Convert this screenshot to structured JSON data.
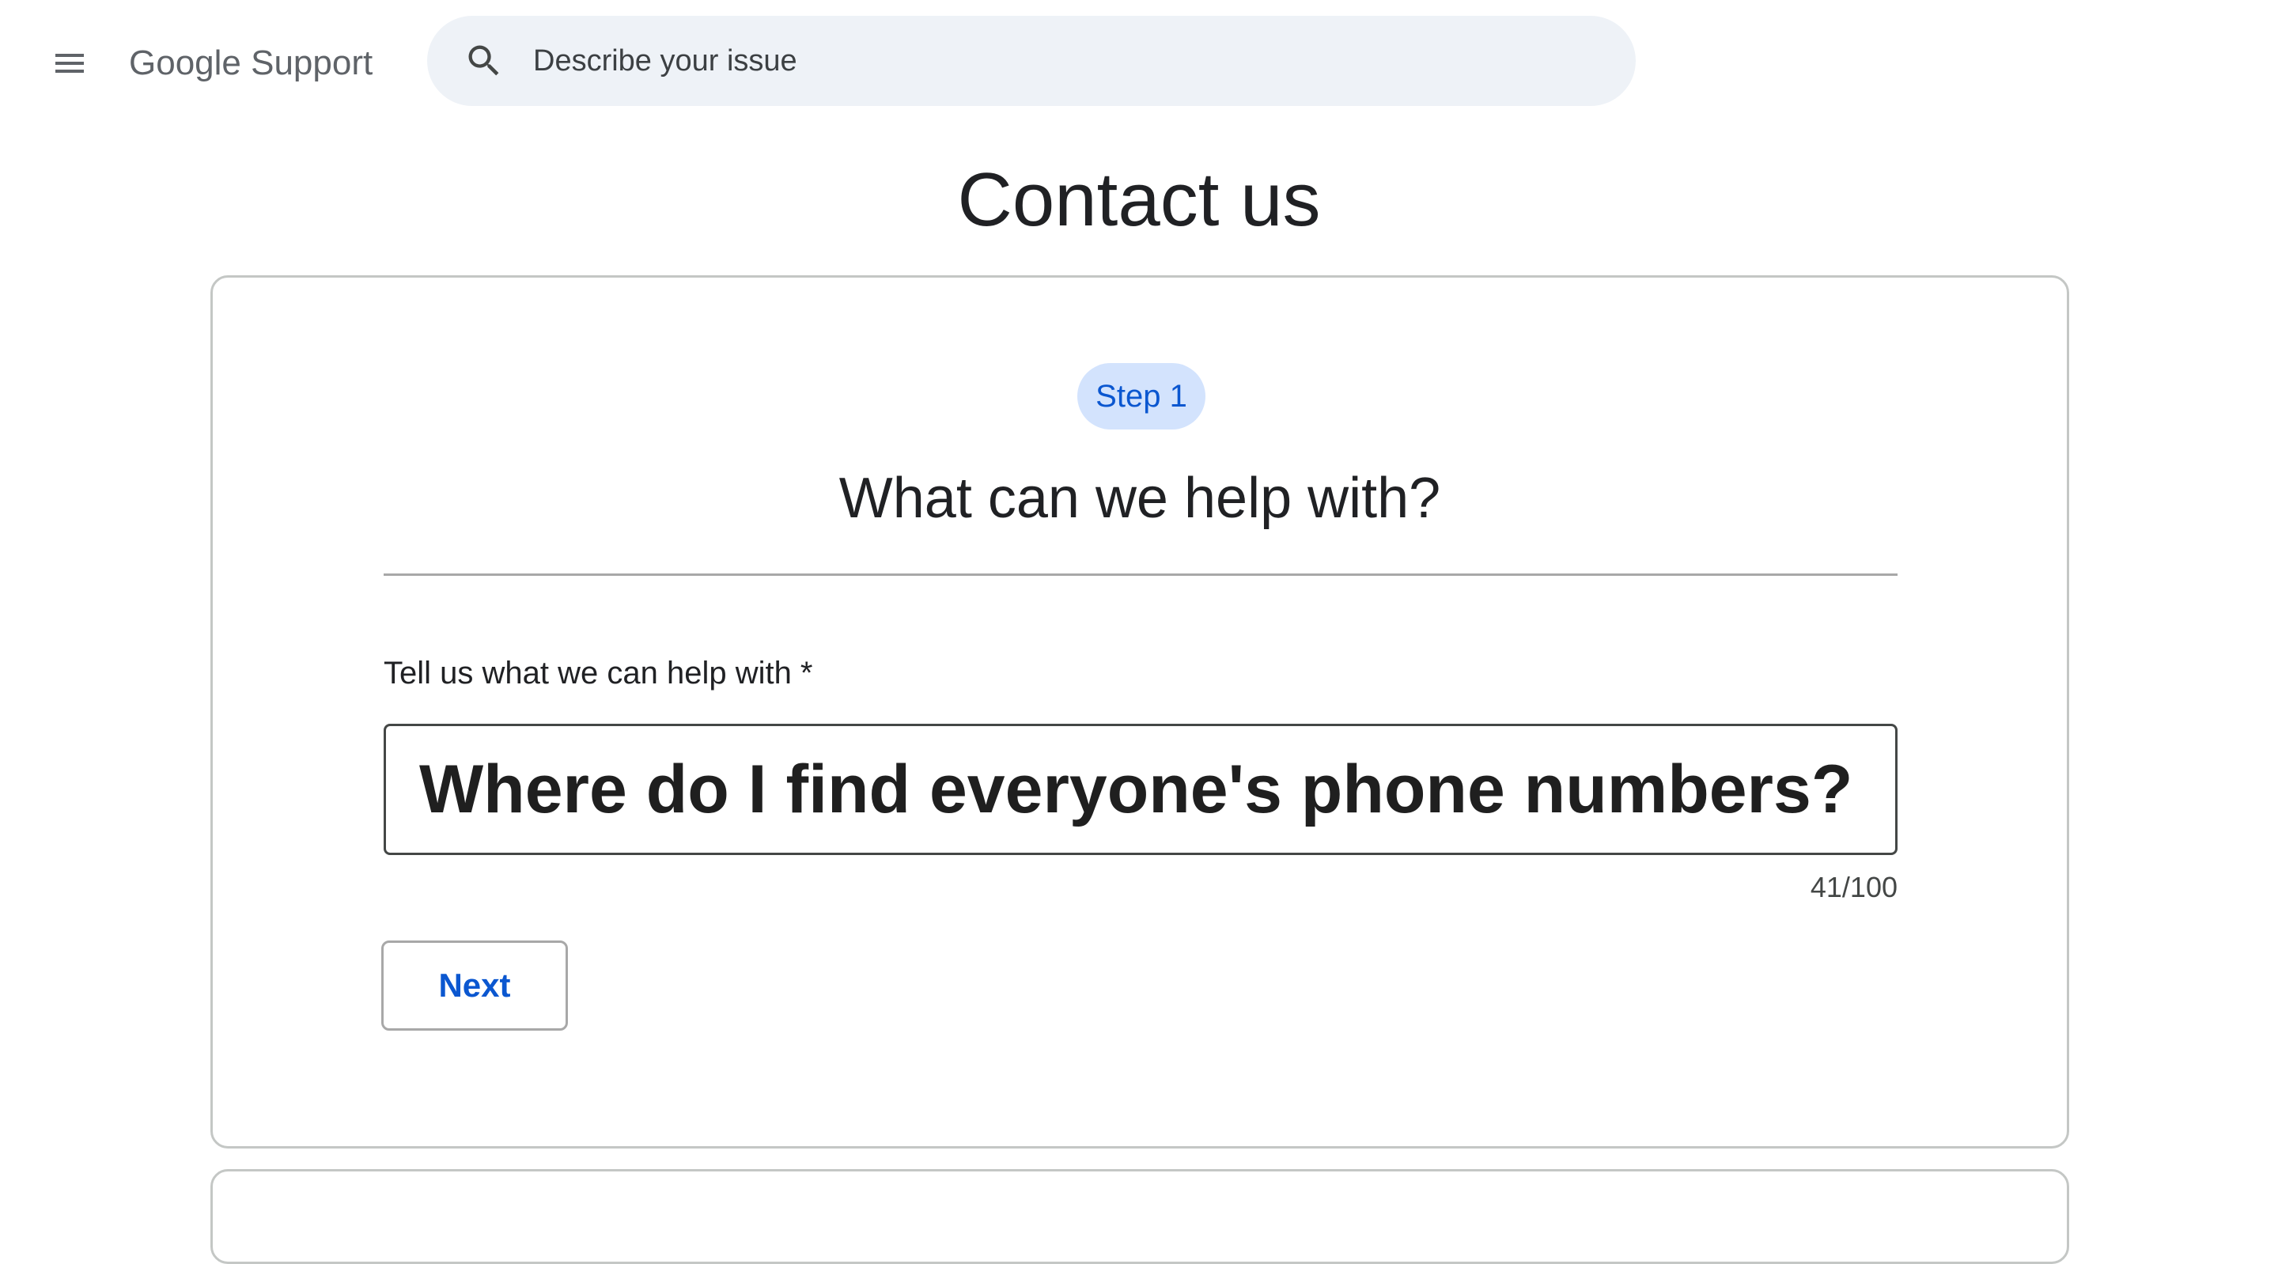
{
  "header": {
    "menu_icon": "hamburger-menu-icon",
    "brand": "Google Support",
    "search": {
      "icon": "search-icon",
      "placeholder": "Describe your issue",
      "value": ""
    }
  },
  "page": {
    "title": "Contact us"
  },
  "step1": {
    "step_label": "Step 1",
    "heading": "What can we help with?",
    "field_label": "Tell us what we can help with *",
    "field_value": "Where do I find everyone's phone numbers?",
    "char_count": "41/100",
    "next_label": "Next"
  },
  "colors": {
    "accent": "#0b57d0",
    "chip_background": "#d3e3fd",
    "search_background": "#eef2f7",
    "card_border": "#c4c7c5"
  }
}
